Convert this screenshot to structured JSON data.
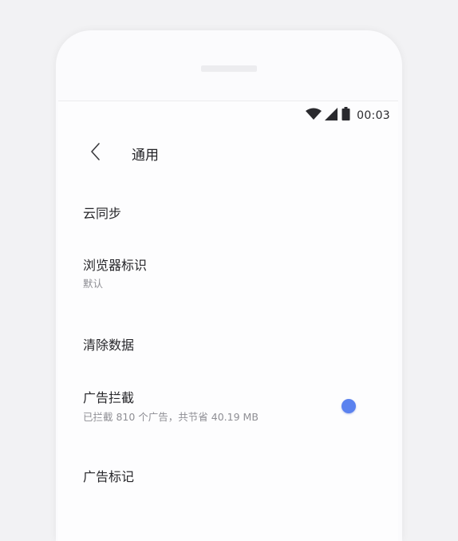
{
  "status_bar": {
    "time": "00:03",
    "icons": [
      "wifi-icon",
      "cellular-signal-icon",
      "battery-icon"
    ]
  },
  "appbar": {
    "back_icon": "chevron-left-icon",
    "title": "通用"
  },
  "settings": {
    "items": [
      {
        "title": "云同步"
      },
      {
        "title": "浏览器标识",
        "subtitle": "默认"
      },
      {
        "title": "清除数据"
      },
      {
        "title": "广告拦截",
        "subtitle": "已拦截 810 个广告，共节省 40.19 MB",
        "toggle_on": true
      },
      {
        "title": "广告标记"
      }
    ]
  },
  "colors": {
    "accent": "#5b82ef",
    "background": "#f2f2f4",
    "text_primary": "#26262a",
    "text_secondary": "#8e8e94"
  }
}
